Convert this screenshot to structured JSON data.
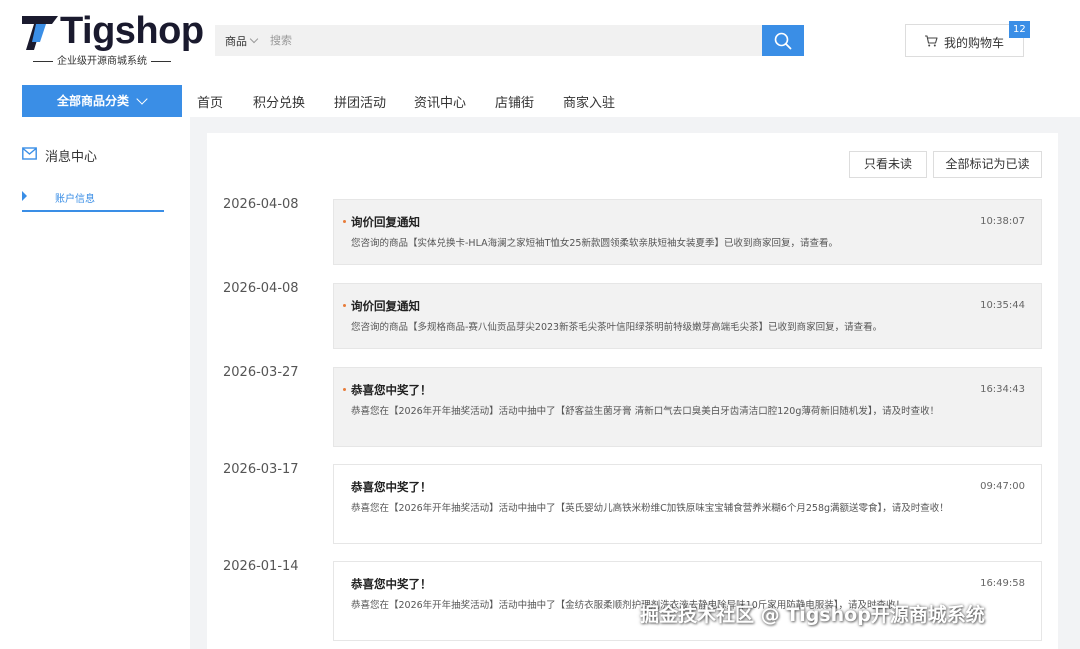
{
  "header": {
    "logo_text": "Tigshop",
    "logo_subtitle": "企业级开源商城系统",
    "search": {
      "category": "商品",
      "placeholder": "搜索"
    },
    "cart": {
      "label": "我的购物车",
      "count": "12"
    }
  },
  "nav": {
    "all_categories": "全部商品分类",
    "links": [
      "首页",
      "积分兑换",
      "拼团活动",
      "资讯中心",
      "店铺街",
      "商家入驻"
    ]
  },
  "sidebar": {
    "title": "消息中心",
    "items": [
      {
        "label": "账户信息"
      }
    ]
  },
  "main": {
    "unread_only_button": "只看未读",
    "mark_all_read_button": "全部标记为已读",
    "messages": [
      {
        "date": "2026-04-08",
        "title": "询价回复通知",
        "time": "10:38:07",
        "unread": true,
        "body": "您咨询的商品【实体兑换卡-HLA海澜之家短袖T恤女25新款圆领柔软亲肤短袖女装夏季】已收到商家回复，请查看。"
      },
      {
        "date": "2026-04-08",
        "title": "询价回复通知",
        "time": "10:35:44",
        "unread": true,
        "body": "您咨询的商品【多规格商品-赛八仙贡品芽尖2023新茶毛尖茶叶信阳绿茶明前特级嫩芽高端毛尖茶】已收到商家回复，请查看。"
      },
      {
        "date": "2026-03-27",
        "title": "恭喜您中奖了！",
        "time": "16:34:43",
        "unread": true,
        "body": "恭喜您在【2026年开年抽奖活动】活动中抽中了【舒客益生菌牙膏 清新口气去口臭美白牙齿清洁口腔120g薄荷新旧随机发】，请及时查收！"
      },
      {
        "date": "2026-03-17",
        "title": "恭喜您中奖了！",
        "time": "09:47:00",
        "unread": false,
        "body": "恭喜您在【2026年开年抽奖活动】活动中抽中了【英氏婴幼儿高铁米粉维C加铁原味宝宝辅食营养米糊6个月258g满额送零食】，请及时查收！"
      },
      {
        "date": "2026-01-14",
        "title": "恭喜您中奖了！",
        "time": "16:49:58",
        "unread": false,
        "body": "恭喜您在【2026年开年抽奖活动】活动中抽中了【金纺衣服柔顺剂护理剂洗衣液去静电除异味10斤家用防静电服装】，请及时查收！"
      }
    ]
  },
  "watermark": "掘金技术社区 @ Tigshop开源商城系统",
  "colors": {
    "accent": "#3a8ee6",
    "unread_dot": "#e87c3a",
    "unread_bg": "#f2f2f2"
  }
}
